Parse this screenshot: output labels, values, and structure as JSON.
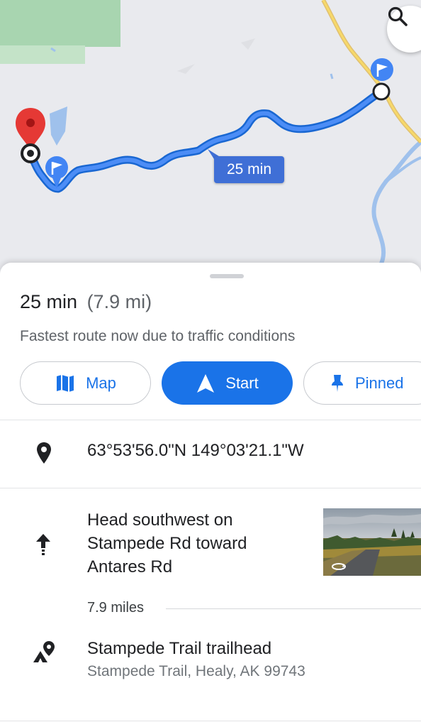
{
  "map": {
    "route_duration_label": "25 min",
    "route_color": "#4285f4",
    "road_color": "#f2c94c",
    "water_color": "#9fc1ec",
    "park_color": "#a8d5b0",
    "origin_pin_color": "#e53935"
  },
  "summary": {
    "duration": "25 min",
    "distance": "(7.9 mi)",
    "note": "Fastest route now due to traffic conditions"
  },
  "actions": {
    "map_label": "Map",
    "start_label": "Start",
    "pinned_label": "Pinned",
    "accent_color": "#1a73e8"
  },
  "origin": {
    "coordinates": "63°53'56.0\"N 149°03'21.1\"W"
  },
  "steps": [
    {
      "instruction": "Head southwest on Stampede Rd toward Antares Rd",
      "distance": "7.9 miles",
      "icon": "arrow-up-icon"
    }
  ],
  "destination": {
    "name": "Stampede Trail trailhead",
    "address": "Stampede Trail, Healy, AK 99743",
    "icon": "trailhead-icon"
  }
}
